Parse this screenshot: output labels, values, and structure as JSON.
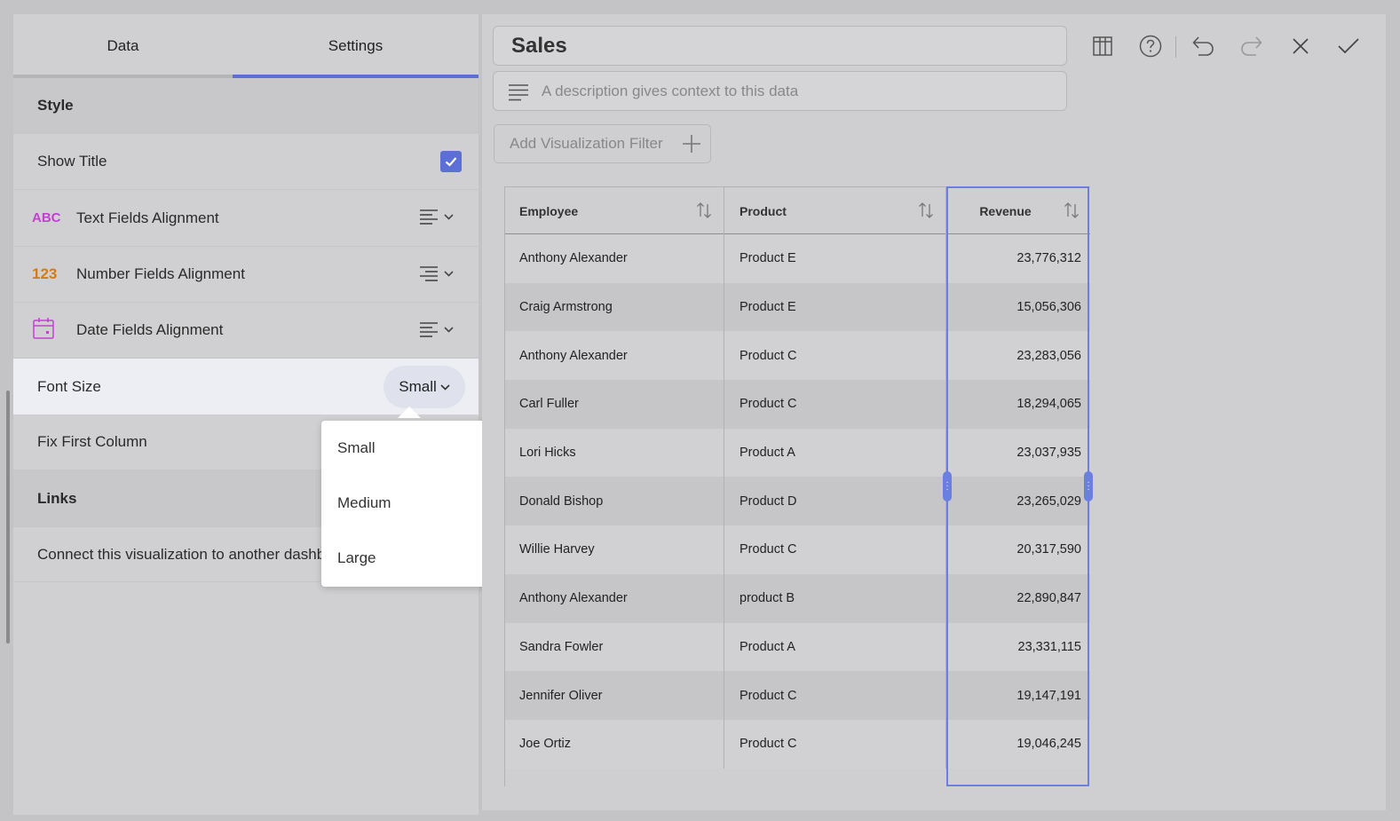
{
  "tabs": {
    "data": "Data",
    "settings": "Settings"
  },
  "settings": {
    "style_header": "Style",
    "show_title": {
      "label": "Show Title",
      "checked": true
    },
    "text_alignment": {
      "icon_text": "ABC",
      "label": "Text Fields Alignment"
    },
    "number_alignment": {
      "icon_text": "123",
      "label": "Number Fields Alignment"
    },
    "date_alignment": {
      "label": "Date Fields Alignment"
    },
    "font_size": {
      "label": "Font Size",
      "value": "Small"
    },
    "fix_first_column": {
      "label": "Fix First Column"
    },
    "links_header": "Links",
    "connect_text": "Connect this visualization to another dashboard"
  },
  "font_size_menu": {
    "options": [
      {
        "label": "Small",
        "selected": true
      },
      {
        "label": "Medium",
        "selected": false
      },
      {
        "label": "Large",
        "selected": false
      }
    ]
  },
  "editor": {
    "title": "Sales",
    "description_placeholder": "A description gives context to this data",
    "filter_button": "Add Visualization Filter"
  },
  "toolbar": {
    "icons": [
      "table-icon",
      "help-icon",
      "undo-icon",
      "redo-icon",
      "close-icon",
      "check-icon"
    ]
  },
  "table": {
    "columns": [
      "Employee",
      "Product",
      "Revenue"
    ],
    "rows": [
      [
        "Anthony Alexander",
        "Product E",
        "23,776,312"
      ],
      [
        "Craig Armstrong",
        "Product E",
        "15,056,306"
      ],
      [
        "Anthony Alexander",
        "Product C",
        "23,283,056"
      ],
      [
        "Carl Fuller",
        "Product C",
        "18,294,065"
      ],
      [
        "Lori Hicks",
        "Product A",
        "23,037,935"
      ],
      [
        "Donald Bishop",
        "Product D",
        "23,265,029"
      ],
      [
        "Willie Harvey",
        "Product C",
        "20,317,590"
      ],
      [
        "Anthony Alexander",
        "product B",
        "22,890,847"
      ],
      [
        "Sandra Fowler",
        "Product A",
        "23,331,115"
      ],
      [
        "Jennifer Oliver",
        "Product C",
        "19,147,191"
      ],
      [
        "Joe Ortiz",
        "Product C",
        "19,046,245"
      ]
    ]
  },
  "colors": {
    "accent": "#5b6fd6",
    "abc_icon": "#c43fd1",
    "num_icon": "#d47b16"
  }
}
